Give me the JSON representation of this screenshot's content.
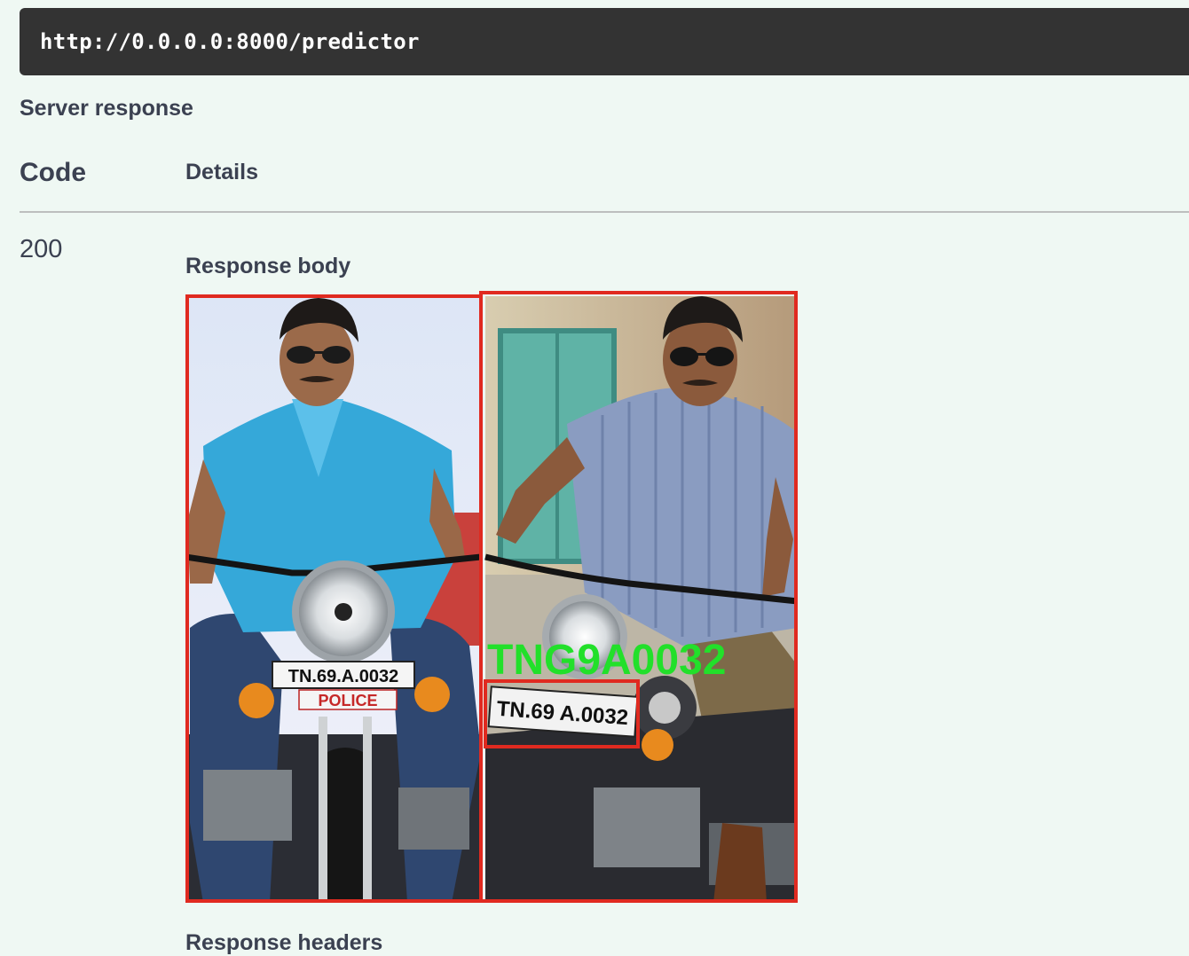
{
  "request": {
    "url": "http://0.0.0.0:8000/predictor"
  },
  "response": {
    "section_title": "Server response",
    "columns": {
      "code": "Code",
      "details": "Details"
    },
    "status_code": "200",
    "body_label": "Response body",
    "headers_label": "Response headers",
    "image": {
      "plate_text_left": "TN.69.A.0032",
      "police_text": "POLICE",
      "plate_text_right": "TN.69 A.0032",
      "predicted_label": "TNG9A0032",
      "box_color": "#e02a20",
      "label_color": "#22e02a"
    }
  }
}
